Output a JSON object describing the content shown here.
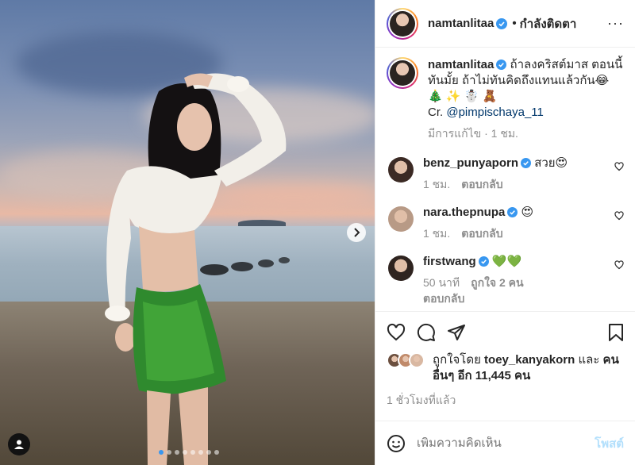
{
  "header": {
    "username": "namtanlitaa",
    "separator": "•",
    "follow_label": "กำลังติดตา",
    "more_label": "···"
  },
  "caption": {
    "username": "namtanlitaa",
    "text": "ถ้าลงคริสต์มาส ตอนนี้ทันมั้ย ถ้าไม่ทันคิดถึงแทนแล้วกัน😂 🎄 ✨ ☃️ 🧸",
    "credit_prefix": "Cr. ",
    "credit_mention": "@pimpischaya_11",
    "meta": "มีการแก้ไข · 1 ชม."
  },
  "comments": [
    {
      "username": "benz_punyaporn",
      "text": "สวย😍",
      "time": "1 ชม.",
      "likes": "",
      "reply": "ตอบกลับ",
      "avatar_color": "#3b2a24"
    },
    {
      "username": "nara.thepnupa",
      "text": "😍",
      "time": "1 ชม.",
      "likes": "",
      "reply": "ตอบกลับ",
      "avatar_color": "#b89a86"
    },
    {
      "username": "firstwang",
      "text": "💚💚",
      "time": "50 นาที",
      "likes": "ถูกใจ 2 คน",
      "reply": "ตอบกลับ",
      "avatar_color": "#2f2420"
    }
  ],
  "likes": {
    "prefix": "ถูกใจโดย ",
    "user": "toey_kanyakorn",
    "middle": " และ ",
    "others": "คนอื่นๆ อีก 11,445 คน",
    "avatar_colors": [
      "#6b4f3f",
      "#c08a6a",
      "#d9b8a2"
    ]
  },
  "time_ago": "1 ชั่วโมงที่แล้ว",
  "add_comment": {
    "placeholder": "เพิ่มความคิดเห็น",
    "post_label": "โพสต์"
  },
  "carousel": {
    "dot_count": 8,
    "active_index": 0
  },
  "colors": {
    "verified": "#3897f0",
    "post_disabled": "#b2dffc",
    "mention": "#00376b",
    "meta_gray": "#8e8e8e"
  },
  "icons": [
    "verified-icon",
    "more-icon",
    "heart-icon",
    "comment-icon",
    "share-icon",
    "save-icon",
    "emoji-icon",
    "next-arrow-icon",
    "user-tag-icon"
  ]
}
